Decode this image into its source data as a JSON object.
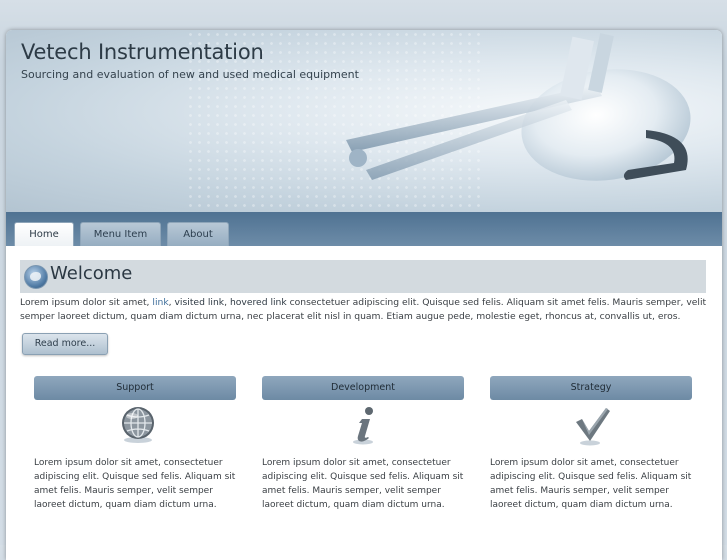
{
  "site": {
    "title": "Vetech Instrumentation",
    "tagline": "Sourcing and evaluation of new and used medical equipment"
  },
  "nav": {
    "tabs": [
      {
        "label": "Home",
        "active": true
      },
      {
        "label": "Menu Item",
        "active": false
      },
      {
        "label": "About",
        "active": false
      }
    ]
  },
  "welcome": {
    "title": "Welcome",
    "intro_start": "Lorem ipsum dolor sit amet, ",
    "link": "link",
    "sep1": ", ",
    "visited_link": "visited link",
    "sep2": ", ",
    "hovered_link": "hovered link",
    "intro_end": " consectetuer adipiscing elit. Quisque sed felis. Aliquam sit amet felis. Mauris semper, velit semper laoreet dictum, quam diam dictum urna, nec placerat elit nisl in quam. Etiam augue pede, molestie eget, rhoncus at, convallis ut, eros.",
    "read_more": "Read more..."
  },
  "columns": [
    {
      "heading": "Support",
      "icon": "globe-icon",
      "text": "Lorem ipsum dolor sit amet, consectetuer adipiscing elit. Quisque sed felis. Aliquam sit amet felis. Mauris semper, velit semper laoreet dictum, quam diam dictum urna."
    },
    {
      "heading": "Development",
      "icon": "info-icon",
      "text": "Lorem ipsum dolor sit amet, consectetuer adipiscing elit. Quisque sed felis. Aliquam sit amet felis. Mauris semper, velit semper laoreet dictum, quam diam dictum urna."
    },
    {
      "heading": "Strategy",
      "icon": "checkmark-icon",
      "text": "Lorem ipsum dolor sit amet, consectetuer adipiscing elit. Quisque sed felis. Aliquam sit amet felis. Mauris semper, velit semper laoreet dictum, quam diam dictum urna."
    }
  ],
  "colors": {
    "nav_bar": "#5a7c9b",
    "link": "#3f6f9b",
    "heading_bar": "#d3dadf",
    "column_head": "#7e98b0"
  }
}
